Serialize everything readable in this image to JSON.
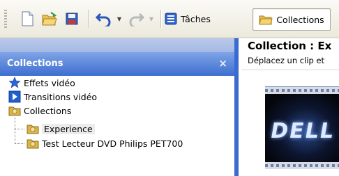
{
  "toolbar": {
    "buttons": [
      {
        "name": "new",
        "icon": "new-document-icon"
      },
      {
        "name": "open",
        "icon": "open-folder-icon"
      },
      {
        "name": "save",
        "icon": "save-disk-icon"
      },
      {
        "name": "undo",
        "icon": "undo-arrow-icon"
      },
      {
        "name": "redo",
        "icon": "redo-arrow-icon",
        "disabled": true
      }
    ],
    "taches_label": "Tâches",
    "collections_label": "Collections"
  },
  "panel": {
    "title": "Collections",
    "close_glyph": "×",
    "tree": [
      {
        "label": "Effets vidéo",
        "icon": "star-icon",
        "color": "#2b63d8"
      },
      {
        "label": "Transitions vidéo",
        "icon": "transition-icon",
        "color": "#1f5fd0"
      },
      {
        "label": "Collections",
        "icon": "collection-folder-icon",
        "color": "#d9b44a"
      },
      {
        "label": "Experience",
        "icon": "collection-folder-icon",
        "color": "#d9b44a",
        "selected": true
      },
      {
        "label": "Test Lecteur DVD Philips PET700",
        "icon": "collection-folder-icon",
        "color": "#d9b44a"
      }
    ]
  },
  "content": {
    "title": "Collection : Ex",
    "subtitle": "Déplacez un clip et",
    "clip_logo": "DELL"
  },
  "colors": {
    "accent": "#3d6fd0",
    "header_light": "#7fa3e6"
  }
}
